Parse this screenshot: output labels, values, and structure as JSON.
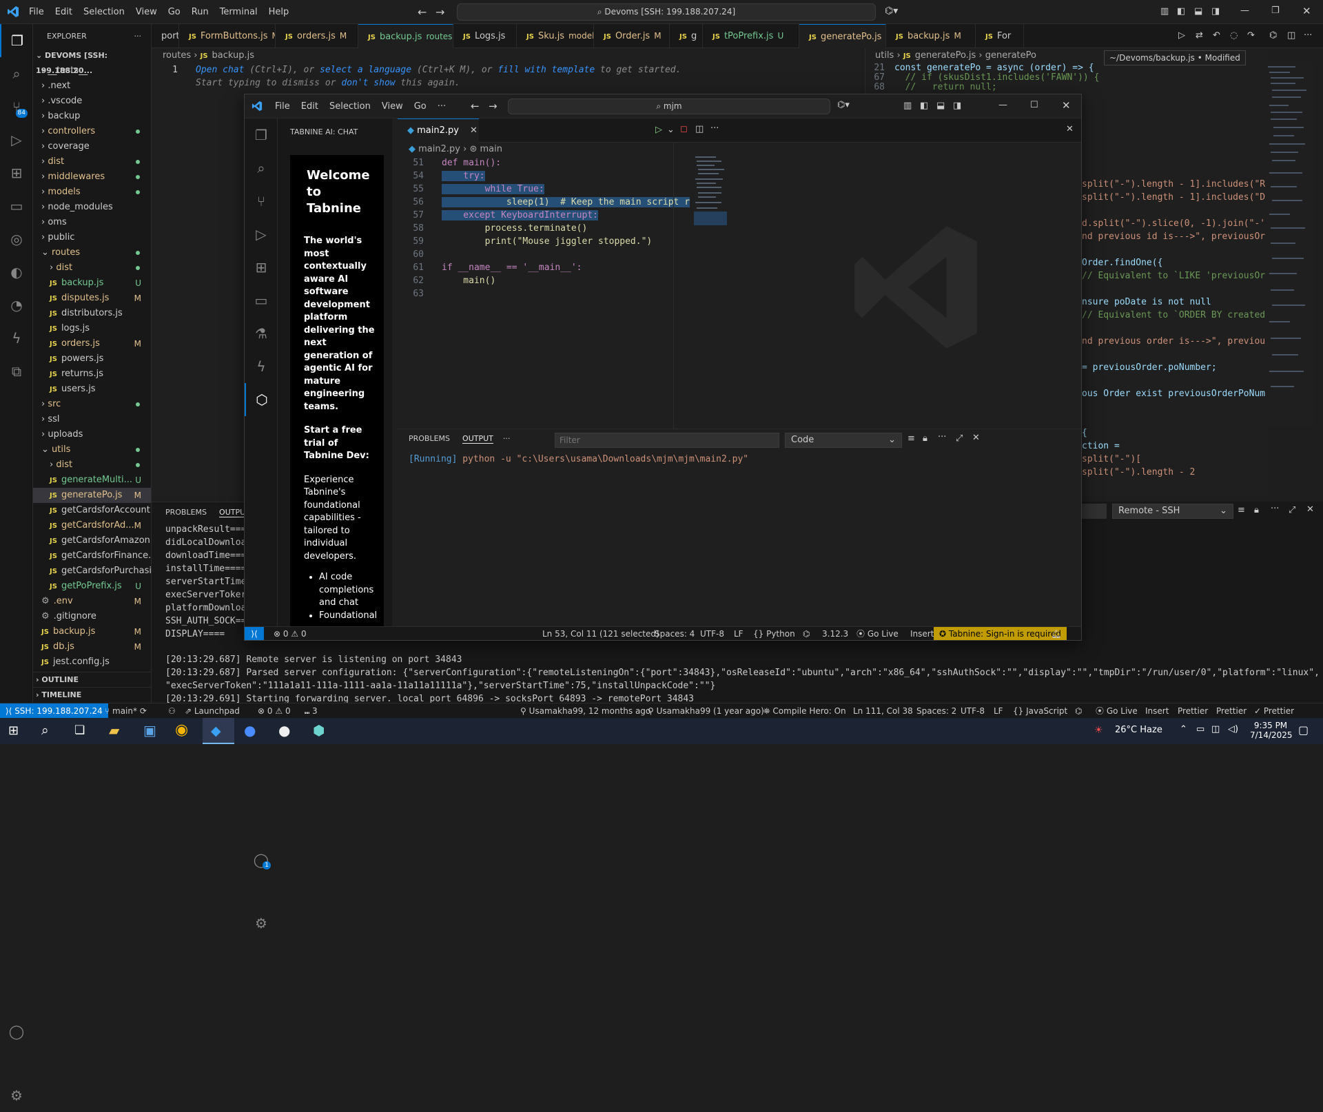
{
  "title_bar": {
    "menu": [
      "File",
      "Edit",
      "Selection",
      "View",
      "Go",
      "Run",
      "Terminal",
      "Help"
    ],
    "search": "Devoms [SSH: 199.188.207.24]"
  },
  "explorer": {
    "header": "EXPLORER",
    "root": "DEVOMS [SSH: 199.188.20...",
    "items": [
      {
        "label": "__tests__",
        "type": "folder",
        "status": ""
      },
      {
        "label": ".next",
        "type": "folder",
        "status": ""
      },
      {
        "label": ".vscode",
        "type": "folder",
        "status": ""
      },
      {
        "label": "backup",
        "type": "folder",
        "status": ""
      },
      {
        "label": "controllers",
        "type": "folder",
        "status": "dot"
      },
      {
        "label": "coverage",
        "type": "folder",
        "status": ""
      },
      {
        "label": "dist",
        "type": "folder",
        "status": "dot"
      },
      {
        "label": "middlewares",
        "type": "folder",
        "status": "dot"
      },
      {
        "label": "models",
        "type": "folder",
        "status": "dot"
      },
      {
        "label": "node_modules",
        "type": "folder",
        "status": ""
      },
      {
        "label": "oms",
        "type": "folder",
        "status": ""
      },
      {
        "label": "public",
        "type": "folder",
        "status": ""
      },
      {
        "label": "routes",
        "type": "folder-open",
        "status": "dot"
      },
      {
        "label": "dist",
        "type": "subfolder",
        "status": "dot"
      },
      {
        "label": "backup.js",
        "type": "file",
        "status": "U"
      },
      {
        "label": "disputes.js",
        "type": "file",
        "status": "M"
      },
      {
        "label": "distributors.js",
        "type": "file",
        "status": ""
      },
      {
        "label": "logs.js",
        "type": "file",
        "status": ""
      },
      {
        "label": "orders.js",
        "type": "file",
        "status": "M"
      },
      {
        "label": "powers.js",
        "type": "file",
        "status": ""
      },
      {
        "label": "returns.js",
        "type": "file",
        "status": ""
      },
      {
        "label": "users.js",
        "type": "file",
        "status": ""
      },
      {
        "label": "src",
        "type": "folder",
        "status": "dot"
      },
      {
        "label": "ssl",
        "type": "folder",
        "status": ""
      },
      {
        "label": "uploads",
        "type": "folder",
        "status": ""
      },
      {
        "label": "utils",
        "type": "folder-open",
        "status": "dot"
      },
      {
        "label": "dist",
        "type": "subfolder",
        "status": "dot"
      },
      {
        "label": "generateMulti...",
        "type": "file",
        "status": "U"
      },
      {
        "label": "generatePo.js",
        "type": "file",
        "status": "M"
      },
      {
        "label": "getCardsforAccount.js",
        "type": "file",
        "status": ""
      },
      {
        "label": "getCardsforAd...",
        "type": "file",
        "status": "M"
      },
      {
        "label": "getCardsforAmazon.js",
        "type": "file",
        "status": ""
      },
      {
        "label": "getCardsforFinance.js",
        "type": "file",
        "status": ""
      },
      {
        "label": "getCardsforPurchasi...",
        "type": "file",
        "status": ""
      },
      {
        "label": "getPoPrefix.js",
        "type": "file",
        "status": "U"
      },
      {
        "label": ".env",
        "type": "root-file",
        "status": "M"
      },
      {
        "label": ".gitignore",
        "type": "root-file",
        "status": ""
      },
      {
        "label": "backup.js",
        "type": "root-js",
        "status": "M"
      },
      {
        "label": "db.js",
        "type": "root-js",
        "status": "M"
      },
      {
        "label": "jest.config.js",
        "type": "root-js",
        "status": ""
      }
    ],
    "outline": "OUTLINE",
    "timeline": "TIMELINE"
  },
  "tabs": [
    {
      "label": "portsOrder.js",
      "badge": ""
    },
    {
      "label": "FormButtons.js",
      "badge": "M"
    },
    {
      "label": "orders.js",
      "badge": "M"
    },
    {
      "label": "backup.js",
      "badge": "routes U"
    },
    {
      "label": "Logs.js",
      "badge": ""
    },
    {
      "label": "Sku.js",
      "badge": "models M"
    },
    {
      "label": "Order.js",
      "badge": "M"
    },
    {
      "label": "g",
      "badge": ""
    },
    {
      "label": "tPoPrefix.js",
      "badge": "U"
    },
    {
      "label": "generatePo.js",
      "badge": "M"
    },
    {
      "label": "backup.js",
      "badge": "M"
    },
    {
      "label": "For",
      "badge": ""
    }
  ],
  "back_editor": {
    "breadcrumb": [
      "routes",
      "backup.js"
    ],
    "hint_line1": {
      "a": "Open chat",
      "b": " (Ctrl+I), or ",
      "c": "select a language",
      "d": " (Ctrl+K M), or ",
      "e": "fill with template",
      "f": " to get started."
    },
    "hint_line2": {
      "a": "Start typing to dismiss or ",
      "b": "don't show",
      "c": " this again."
    },
    "right_breadcrumb": [
      "utils",
      "generatePo.js",
      "generatePo"
    ],
    "tooltip": "~/Devoms/backup.js • Modified",
    "right_top_lines": [
      {
        "num": "21",
        "code": "const generatePo = async (order) => {"
      },
      {
        "num": "67",
        "code": "  // if (skusDist1.includes('FAWN')) {"
      },
      {
        "num": "68",
        "code": "  //   return null;"
      }
    ],
    "right_code": [
      "split(\"-\").length - 1].includes(\"R'",
      "split(\"-\").length - 1].includes(\"D'",
      "",
      "d.split(\"-\").slice(0, -1).join(\"-'",
      "nd previous id is--->\", previousOr",
      "",
      "Order.findOne({",
      "// Equivalent to `LIKE 'previousOr",
      "",
      "nsure poDate is not null",
      "// Equivalent to `ORDER BY created",
      "",
      "nd previous order is--->\", previou",
      "",
      "= previousOrder.poNumber;",
      "",
      "ous Order exist previousOrderPoNum,",
      "",
      "",
      "{",
      "ction =",
      "split(\"-\")[",
      "split(\"-\").length - 2"
    ]
  },
  "bottom_panel": {
    "tabs": [
      "PROBLEMS",
      "OUTPU"
    ],
    "dropdown": "Remote - SSH",
    "output_lines": [
      "unpackResult===",
      "didLocalDownloa",
      "downloadTime===",
      "installTime====",
      "serverStartTime",
      "execServerToker",
      "platformDownloa",
      "SSH_AUTH_SOCK==",
      "DISPLAY===="
    ],
    "log_lines": [
      "[20:13:29.687] Remote server is listening on port 34843",
      "[20:13:29.687] Parsed server configuration: {\"serverConfiguration\":{\"remoteListeningOn\":{\"port\":34843},\"osReleaseId\":\"ubuntu\",\"arch\":\"x86_64\",\"sshAuthSock\":\"\",\"display\":\"\",\"tmpDir\":\"/run/user/0\",\"platform\":\"linux\",",
      "\"execServerToken\":\"111a1a11-111a-1111-aa1a-11a11a11111a\"},\"serverStartTime\":75,\"installUnpackCode\":\"\"}",
      "[20:13:29.691] Starting forwarding server. local port 64896 -> socksPort 64893 -> remotePort 34843"
    ]
  },
  "status_bar": {
    "remote": "SSH: 199.188.207.24",
    "branch": "main*",
    "launchpad": "Launchpad",
    "errors": "0",
    "warnings": "0",
    "ports": "3",
    "blame1": "Usamakha99, 12 months ago",
    "blame2": "Usamakha99 (1 year ago)",
    "compile": "Compile Hero: On",
    "position": "Ln 111, Col 38",
    "spaces": "Spaces: 2",
    "encoding": "UTF-8",
    "eol": "LF",
    "lang": "JavaScript",
    "golive": "Go Live",
    "insert": "Insert",
    "prettier1": "Prettier",
    "prettier2": "Prettier",
    "prettier3": "Prettier"
  },
  "front_window": {
    "menu": [
      "File",
      "Edit",
      "Selection",
      "View",
      "Go"
    ],
    "search": "mjm",
    "chat_header": "TABNINE AI: CHAT",
    "chat_title": "Welcome to Tabnine",
    "chat_intro": "The world's most contextually aware AI software development platform delivering the next generation of agentic AI for mature engineering teams.",
    "chat_trial": "Start a free trial of Tabnine Dev:",
    "chat_desc": "Experience Tabnine's foundational capabilities - tailored to individual developers.",
    "chat_bullets": [
      "AI code completions and chat",
      "Foundational"
    ],
    "tab": "main2.py",
    "breadcrumb": [
      "main2.py",
      "main"
    ],
    "code": [
      {
        "num": "51",
        "text": "def main():"
      },
      {
        "num": "54",
        "text": "    try:"
      },
      {
        "num": "55",
        "text": "        while True:"
      },
      {
        "num": "56",
        "text": "            sleep(1)  # Keep the main script r"
      },
      {
        "num": "57",
        "text": "    except KeyboardInterrupt:"
      },
      {
        "num": "58",
        "text": "        process.terminate()"
      },
      {
        "num": "59",
        "text": "        print(\"Mouse jiggler stopped.\")"
      },
      {
        "num": "60",
        "text": ""
      },
      {
        "num": "61",
        "text": "if __name__ == '__main__':"
      },
      {
        "num": "62",
        "text": "    main()"
      },
      {
        "num": "63",
        "text": ""
      }
    ],
    "panel_tabs": [
      "PROBLEMS",
      "OUTPUT"
    ],
    "filter_placeholder": "Filter",
    "output_channel": "Code",
    "output_running": "[Running]",
    "output_cmd": " python -u \"c:\\Users\\usama\\Downloads\\mjm\\mjm\\main2.py\"",
    "status": {
      "errors": "0",
      "warnings": "0",
      "position": "Ln 53, Col 11 (121 selected)",
      "spaces": "Spaces: 4",
      "encoding": "UTF-8",
      "eol": "LF",
      "lang": "Python",
      "version": "3.12.3",
      "golive": "Go Live",
      "insert": "Insert",
      "tabnine": "Tabnine: Sign-in is required"
    },
    "notif_badge": "1"
  },
  "taskbar": {
    "weather": "26°C  Haze",
    "time": "9:35 PM",
    "date": "7/14/2025"
  },
  "badges": {
    "scm": "84"
  },
  "colors": {
    "accent": "#0078d4",
    "tabnine": "#c19c00",
    "modified": "#e2c08d",
    "untracked": "#73c991"
  }
}
